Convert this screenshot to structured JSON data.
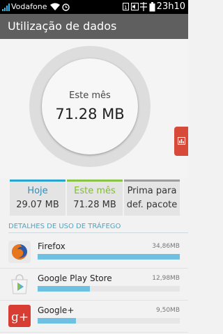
{
  "statusbar": {
    "carrier": "Vodafone",
    "time": "23h10",
    "battery": 1.0
  },
  "appbar": {
    "title": "Utilização de dados"
  },
  "dial": {
    "label": "Este mês",
    "value": "71.28 MB"
  },
  "cards": [
    {
      "line1": "Hoje",
      "line2": "29.07 MB",
      "color": "#2aa3cf",
      "text_color": "#2a8fbd"
    },
    {
      "line1": "Este mês",
      "line2": "71.28 MB",
      "color": "#8bc34a",
      "text_color": "#7fbf2a"
    },
    {
      "line1": "Prima para",
      "line2": "def. pacote",
      "color": "#9e9e9e",
      "text_color": "#333333"
    }
  ],
  "section_title": "DETALHES DE USO DE TRÁFEGO",
  "apps": [
    {
      "name": "Firefox",
      "size": "34,86MB",
      "fraction": 1.0,
      "icon": "firefox-icon"
    },
    {
      "name": "Google Play Store",
      "size": "12,98MB",
      "fraction": 0.37,
      "icon": "play-store-icon"
    },
    {
      "name": "Google+",
      "size": "9,50MB",
      "fraction": 0.27,
      "icon": "google-plus-icon"
    }
  ],
  "colors": {
    "appbar": "#5f5f5f",
    "accent": "#6ec1e2",
    "sidetab": "#d74a3a"
  }
}
